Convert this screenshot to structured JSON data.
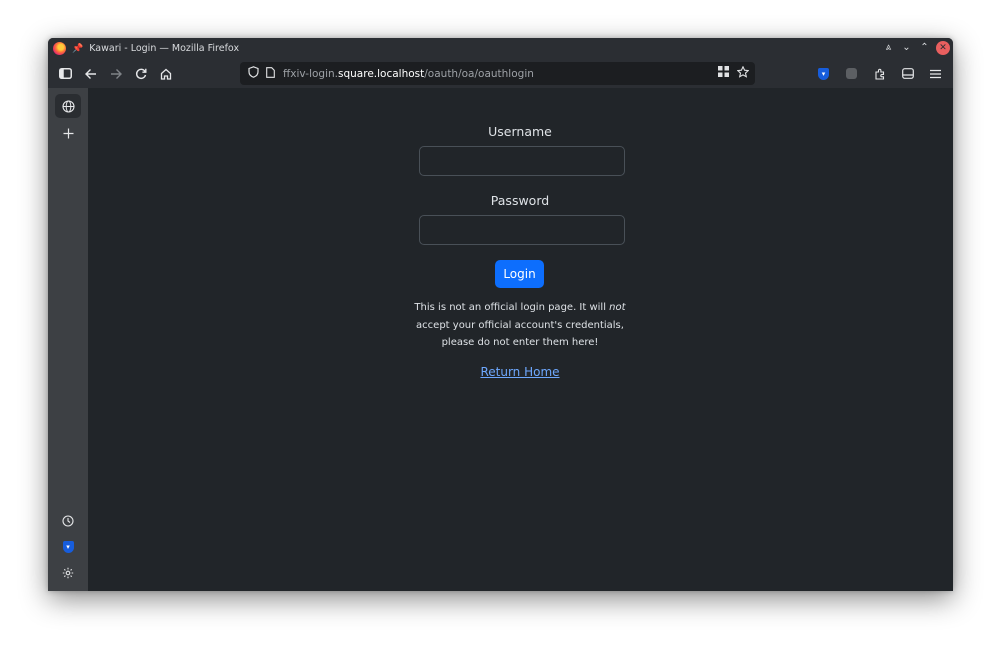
{
  "window": {
    "title": "Kawari - Login — Mozilla Firefox",
    "controls": {
      "shade": "⩓",
      "minimize": "⌄",
      "maximize": "⌃",
      "close": "✕"
    }
  },
  "toolbar": {
    "icons": {
      "sidebar_toggle": "sidebar-icon",
      "back": "arrow-left-icon",
      "forward": "arrow-right-icon",
      "reload": "reload-icon",
      "home": "home-icon"
    }
  },
  "urlbar": {
    "prefix": "ffxiv-login.",
    "host": "square.localhost",
    "path": "/oauth/oa/oauthlogin"
  },
  "sidebar": {
    "icons": [
      "globe-icon",
      "plus-icon",
      "history-icon",
      "bitwarden-icon",
      "settings-icon"
    ]
  },
  "form": {
    "username_label": "Username",
    "username_value": "",
    "password_label": "Password",
    "password_value": "",
    "login_label": "Login",
    "note_line1_start": "This is not an official login page. It will ",
    "note_line1_em": "not",
    "note_line2": "accept your official account's credentials,",
    "note_line3": "please do not enter them here!",
    "return_home": "Return Home"
  },
  "colors": {
    "page_bg": "#212529",
    "primary_button": "#0d6efd",
    "link": "#6ea8fe",
    "chrome": "#2b2e33",
    "sidebar": "#3d4044"
  }
}
